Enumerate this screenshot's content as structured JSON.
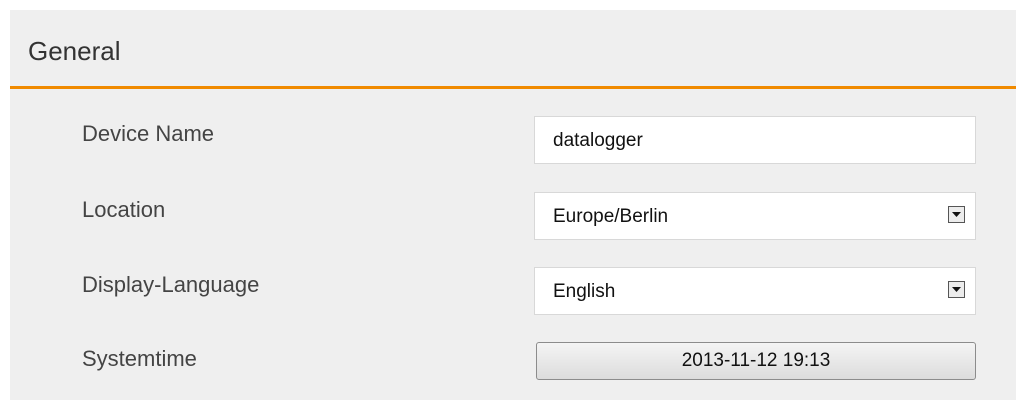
{
  "section": {
    "title": "General"
  },
  "settings": {
    "device_name": {
      "label": "Device Name",
      "value": "datalogger"
    },
    "location": {
      "label": "Location",
      "selected": "Europe/Berlin"
    },
    "display_language": {
      "label": "Display-Language",
      "selected": "English"
    },
    "systemtime": {
      "label": "Systemtime",
      "button_label": "2013-11-12 19:13"
    }
  },
  "colors": {
    "accent_rule": "#f08a00",
    "panel_background": "#efefef"
  },
  "icons": {
    "select_arrow": "chevron-down-icon"
  }
}
